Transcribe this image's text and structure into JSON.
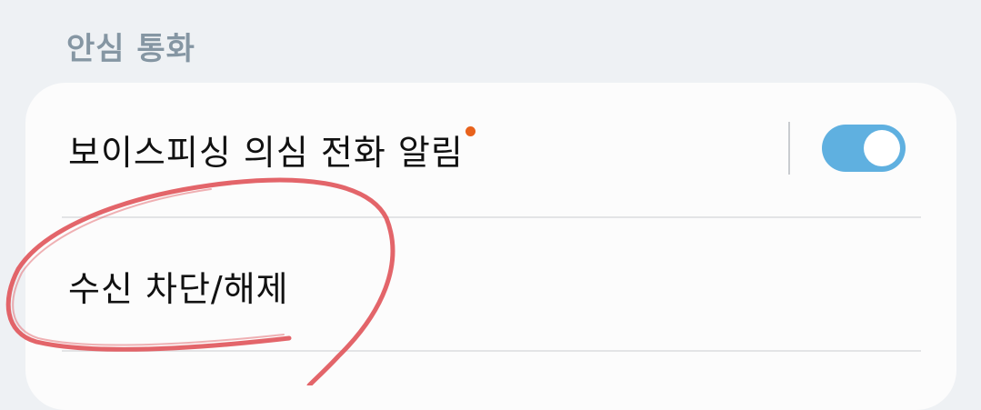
{
  "section": {
    "header": "안심 통화"
  },
  "settings": {
    "row1": {
      "label": "보이스피싱 의심 전화 알림",
      "has_new_badge": true,
      "toggle_on": true
    },
    "row2": {
      "label": "수신 차단/해제"
    }
  },
  "colors": {
    "background": "#eef1f4",
    "card": "#fcfcfc",
    "header_text": "#8596a3",
    "toggle_on": "#5fb0e0",
    "badge_dot": "#e8621c",
    "annotation_stroke": "#e0545a"
  }
}
